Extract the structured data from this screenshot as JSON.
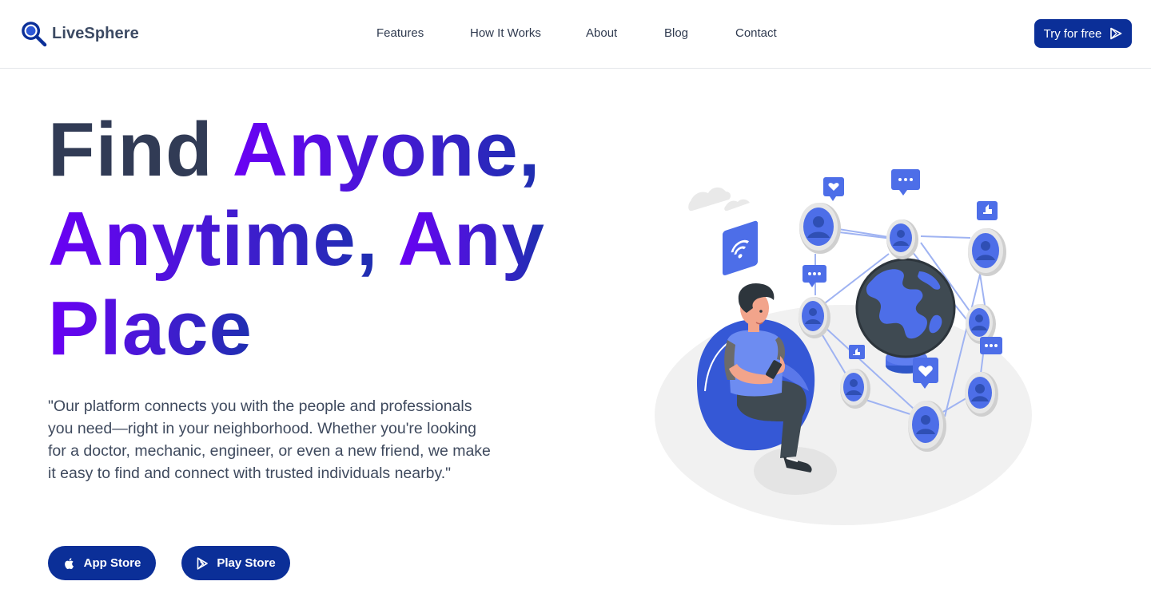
{
  "brand": {
    "name": "LiveSphere",
    "icon": "magnifier-icon"
  },
  "nav": {
    "links": [
      {
        "label": "Features"
      },
      {
        "label": "How It Works"
      },
      {
        "label": "About"
      },
      {
        "label": "Blog"
      },
      {
        "label": "Contact"
      }
    ],
    "cta_label": "Try for free",
    "cta_icon": "play-icon"
  },
  "hero": {
    "title_words": [
      "Find",
      "Anyone,",
      "Anytime,",
      "Any",
      "Place"
    ],
    "description": "\"Our platform connects you with the people and professionals you need—right in your neighborhood. Whether you're looking for a doctor, mechanic, engineer, or even a new friend, we make it easy to find and connect with trusted individuals nearby.\"",
    "buttons": {
      "app_store": {
        "label": "App Store",
        "icon": "apple-icon"
      },
      "play_store": {
        "label": "Play Store",
        "icon": "play-store-icon"
      }
    }
  },
  "colors": {
    "primary": "#0b2f98",
    "gradient_start": "#6a00f4",
    "gradient_end": "#1e2fb0",
    "title_dark": "#313b55",
    "illustration_blue": "#4d6ee8",
    "globe_dark": "#3f4a52"
  }
}
